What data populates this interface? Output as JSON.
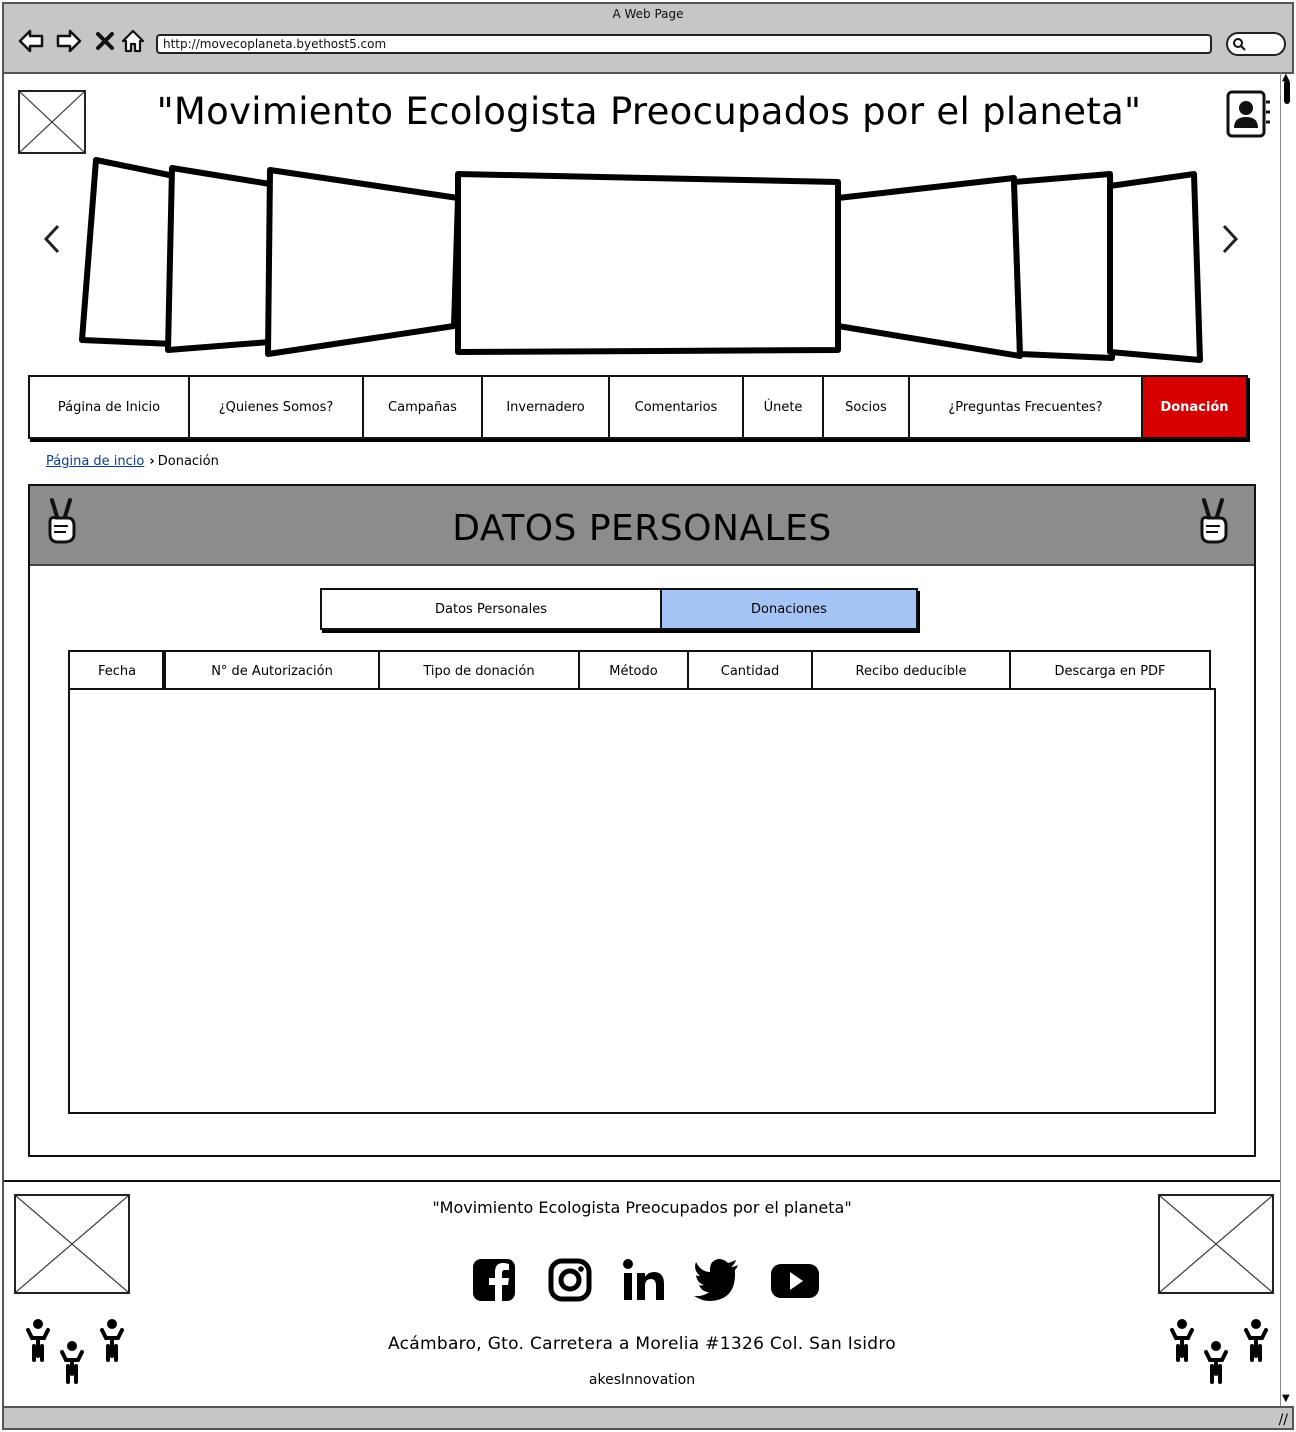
{
  "browser": {
    "window_title": "A Web Page",
    "url": "http://movecoplaneta.byethost5.com"
  },
  "header": {
    "site_title": "\"Movimiento Ecologista Preocupados por el planeta\""
  },
  "nav": {
    "items": [
      {
        "label": "Página de Inicio"
      },
      {
        "label": "¿Quienes Somos?"
      },
      {
        "label": "Campañas"
      },
      {
        "label": "Invernadero"
      },
      {
        "label": "Comentarios"
      },
      {
        "label": "Únete"
      },
      {
        "label": "Socios"
      },
      {
        "label": "¿Preguntas Frecuentes?"
      },
      {
        "label": "Donación"
      }
    ],
    "active_color": "#d60000"
  },
  "breadcrumb": {
    "home": "Página de incio",
    "current": "Donación"
  },
  "panel": {
    "title": "DATOS PERSONALES",
    "tabs": [
      {
        "label": "Datos Personales",
        "selected": false
      },
      {
        "label": "Donaciones",
        "selected": true
      }
    ],
    "selected_tab_color": "#a4c4f5",
    "table": {
      "columns": [
        "Fecha",
        "N° de Autorización",
        "Tipo de donación",
        "Método",
        "Cantidad",
        "Recibo deducible",
        "Descarga en PDF"
      ],
      "rows": []
    }
  },
  "footer": {
    "title": "\"Movimiento Ecologista Preocupados por el planeta\"",
    "social_icons": [
      "facebook-icon",
      "instagram-icon",
      "linkedin-icon",
      "twitter-icon",
      "youtube-icon"
    ],
    "address": "Acámbaro, Gto. Carretera a Morelia #1326 Col. San Isidro",
    "credit": "akesInnovation"
  }
}
